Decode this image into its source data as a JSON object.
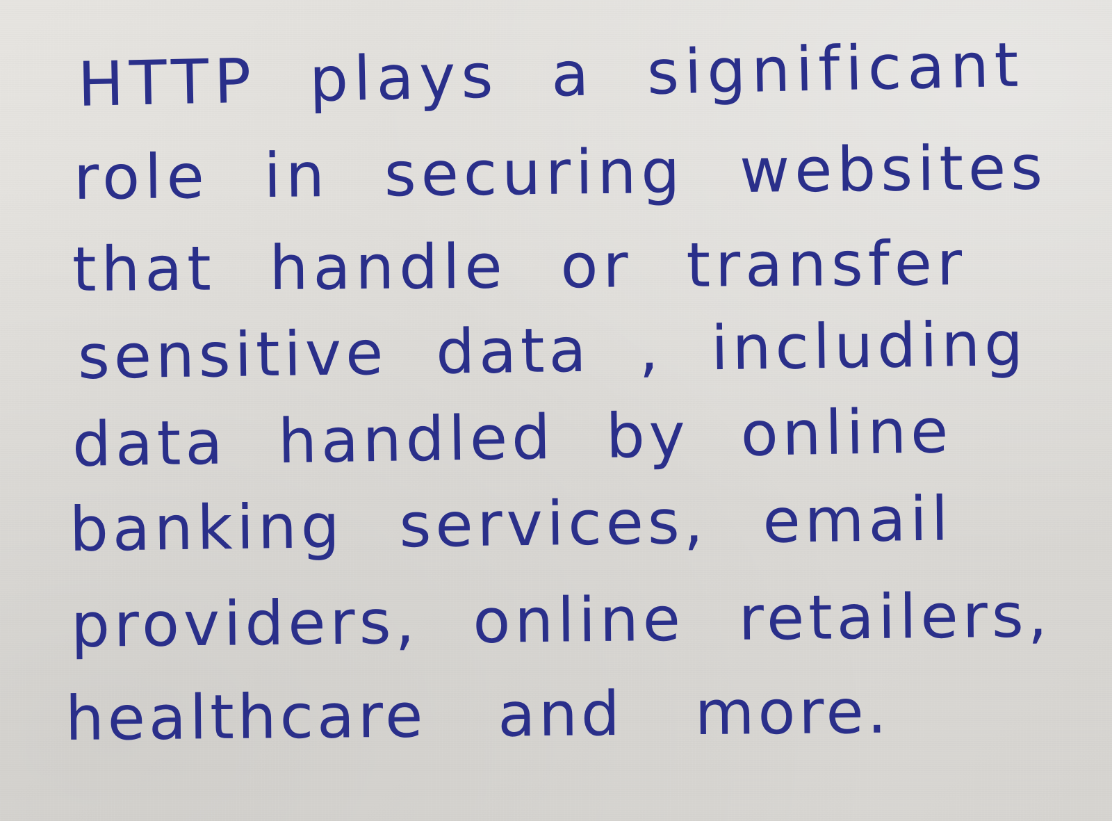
{
  "handwritten_note": {
    "lines": [
      "HTTP plays a significant",
      "role in securing websites",
      "that handle or transfer",
      "sensitive data , including",
      "data handled by online",
      "banking services, email",
      "providers, online retailers,",
      "healthcare and more."
    ]
  },
  "colors": {
    "ink": "#2a2f8a",
    "paper": "#dddbd7"
  }
}
